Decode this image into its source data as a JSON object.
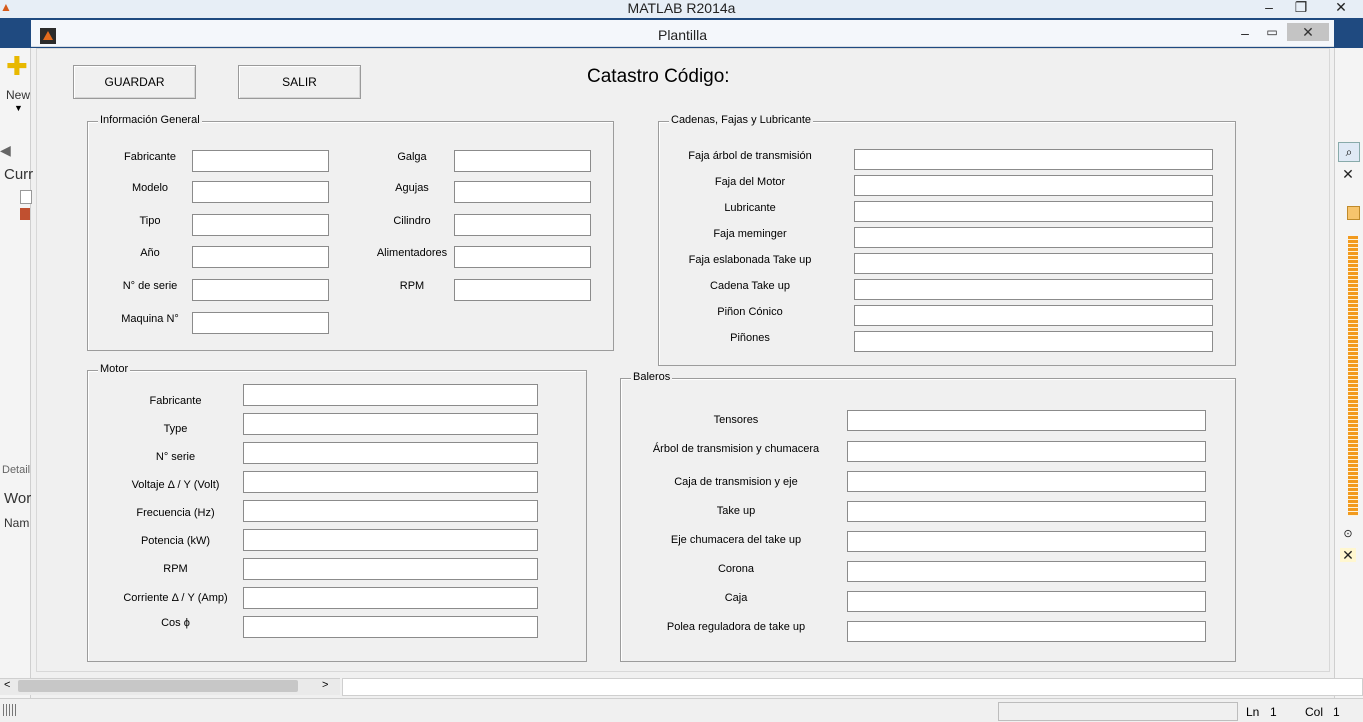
{
  "outer_window": {
    "title": "MATLAB R2014a",
    "left_labels": [
      "New",
      "Curr",
      "Detail",
      "Wor",
      "Nam"
    ],
    "status": {
      "ln_label": "Ln",
      "ln_value": "1",
      "col_label": "Col",
      "col_value": "1"
    }
  },
  "figure": {
    "title": "Plantilla",
    "heading": "Catastro Código:",
    "buttons": {
      "save": "GUARDAR",
      "exit": "SALIR"
    }
  },
  "panels": {
    "general": {
      "title": "Información General",
      "left_labels": [
        "Fabricante",
        "Modelo",
        "Tipo",
        "Año",
        "N° de serie",
        "Maquina N°"
      ],
      "right_labels": [
        "Galga",
        "Agujas",
        "Cilindro",
        "Alimentadores",
        "RPM"
      ]
    },
    "motor": {
      "title": "Motor",
      "labels": [
        "Fabricante",
        "Type",
        "N° serie",
        "Voltaje  Δ  / Y (Volt)",
        "Frecuencia (Hz)",
        "Potencia (kW)",
        "RPM",
        "Corriente  Δ  / Y (Amp)",
        "Cos  ϕ"
      ]
    },
    "chains": {
      "title": "Cadenas, Fajas y Lubricante",
      "labels": [
        "Faja árbol de transmisión",
        "Faja del Motor",
        "Lubricante",
        "Faja meminger",
        "Faja eslabonada Take up",
        "Cadena Take up",
        "Piñon Cónico",
        "Piñones"
      ]
    },
    "bearings": {
      "title": "Baleros",
      "labels": [
        "Tensores",
        "Árbol de transmision y chumacera",
        "Caja de transmision y eje",
        "Take up",
        "Eje chumacera del take up",
        "Corona",
        "Caja",
        "Polea reguladora de take up"
      ]
    }
  }
}
